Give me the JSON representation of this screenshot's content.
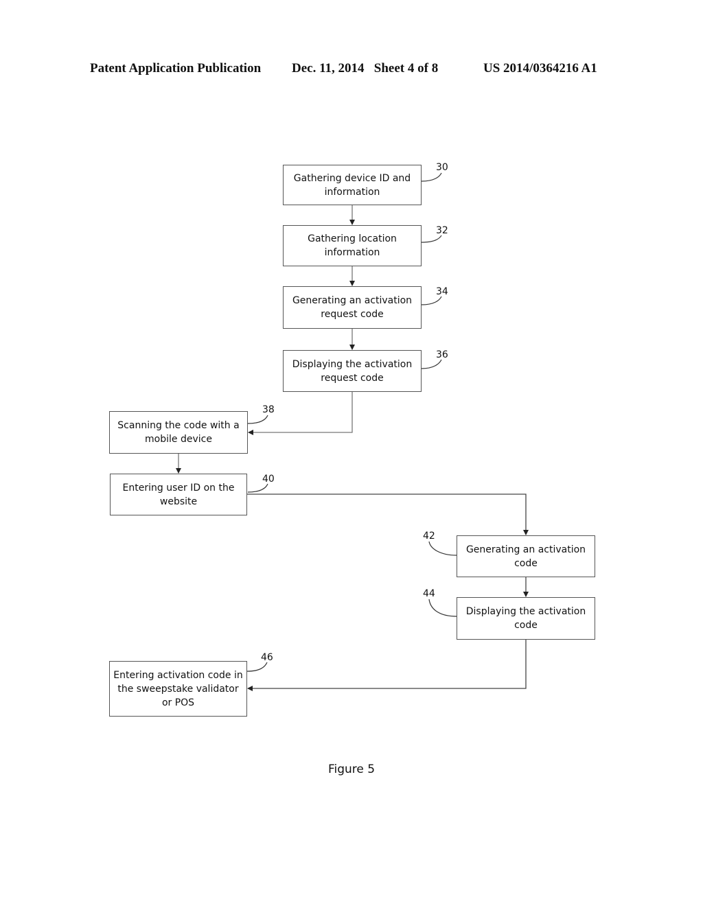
{
  "header": {
    "publication": "Patent Application Publication",
    "date_sheet": "Dec. 11, 2014   Sheet 4 of 8",
    "number": "US 2014/0364216 A1"
  },
  "steps": [
    {
      "ref": "30",
      "label": "Gathering device ID and information"
    },
    {
      "ref": "32",
      "label": "Gathering location information"
    },
    {
      "ref": "34",
      "label": "Generating an activation request code"
    },
    {
      "ref": "36",
      "label": "Displaying the activation request code"
    },
    {
      "ref": "38",
      "label": "Scanning the code with a mobile device"
    },
    {
      "ref": "40",
      "label": "Entering user ID on the website"
    },
    {
      "ref": "42",
      "label": "Generating an activation code"
    },
    {
      "ref": "44",
      "label": "Displaying the activation code"
    },
    {
      "ref": "46",
      "label": "Entering activation code in the sweepstake validator or POS"
    }
  ],
  "flow": [
    [
      "30",
      "32"
    ],
    [
      "32",
      "34"
    ],
    [
      "34",
      "36"
    ],
    [
      "36",
      "38"
    ],
    [
      "38",
      "40"
    ],
    [
      "40",
      "42"
    ],
    [
      "42",
      "44"
    ],
    [
      "44",
      "46"
    ]
  ],
  "figure_caption": "Figure 5"
}
